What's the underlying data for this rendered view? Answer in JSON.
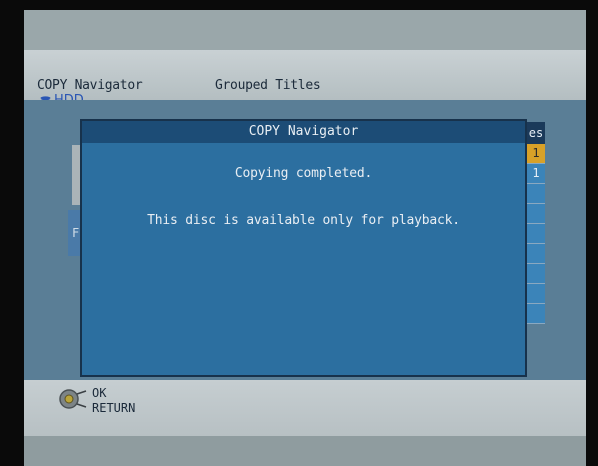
{
  "header": {
    "title": "COPY Navigator",
    "tab": "Grouped Titles",
    "drive": "HDD",
    "drive_icon": "hdd-icon"
  },
  "background": {
    "left_letter": "F",
    "right_header": "es",
    "right_cells": [
      "1",
      "1",
      "",
      "",
      "",
      "",
      "",
      "",
      ""
    ]
  },
  "dialog": {
    "title": "COPY Navigator",
    "line1": "Copying completed.",
    "line2": "This disc is available only for playback."
  },
  "footer": {
    "ok_label": "OK",
    "return_label": "RETURN",
    "remote_icon": "remote-dial-icon"
  },
  "colors": {
    "dialog_bg": "#2c6fa0",
    "dialog_title_bg": "#1c4c76",
    "highlight": "#d8a128"
  }
}
